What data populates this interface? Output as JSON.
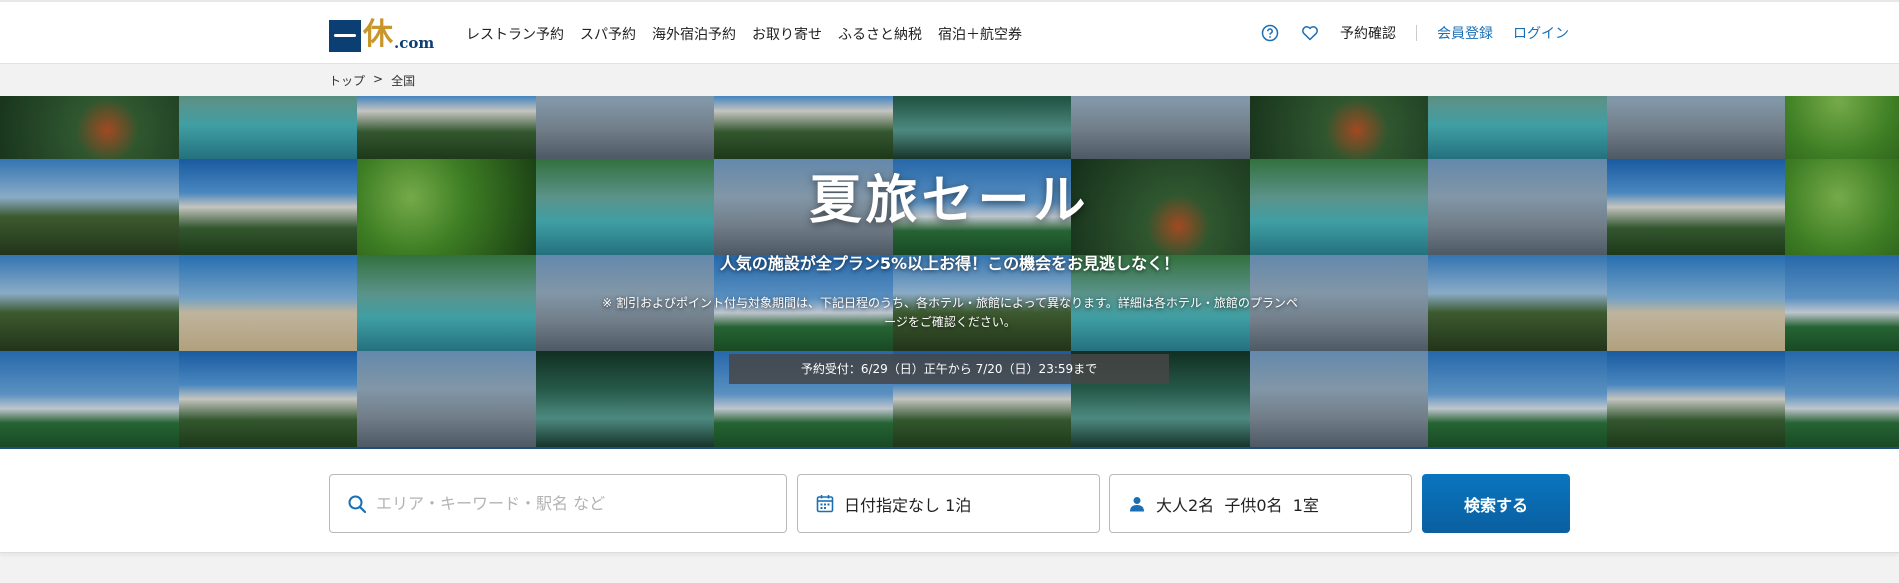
{
  "header": {
    "logo": {
      "kanji": "休",
      "suffix": ".com"
    },
    "nav": [
      "レストラン予約",
      "スパ予約",
      "海外宿泊予約",
      "お取り寄せ",
      "ふるさと納税",
      "宿泊＋航空券"
    ],
    "help_icon": "question-circle-icon",
    "favorite_icon": "heart-icon",
    "reservation_check": "予約確認",
    "register": "会員登録",
    "login": "ログイン"
  },
  "breadcrumb": {
    "top": "トップ",
    "separator": ">",
    "current": "全国"
  },
  "hero": {
    "title": "夏旅セール",
    "subtitle": "人気の施設が全プラン5%以上お得！この機会をお見逃しなく！",
    "note": "※ 割引およびポイント付与対象期間は、下記日程のうち、各ホテル・旅館によって異なります。詳細は各ホテル・旅館のプランページをご確認ください。",
    "period": "予約受付：6/29（日）正午から 7/20（日）23:59まで"
  },
  "search": {
    "area_placeholder": "エリア・キーワード・駅名 など",
    "area_icon": "search-icon",
    "date_icon": "calendar-icon",
    "date_value": "日付指定なし 1泊",
    "guest_icon": "person-icon",
    "guest_value": "大人2名  子供0名  1室",
    "button_label": "検索する"
  },
  "colors": {
    "brand_navy": "#0b3f74",
    "brand_gold": "#c8962a",
    "link_blue": "#1a6fb5",
    "button_blue": "#0a6aae"
  }
}
